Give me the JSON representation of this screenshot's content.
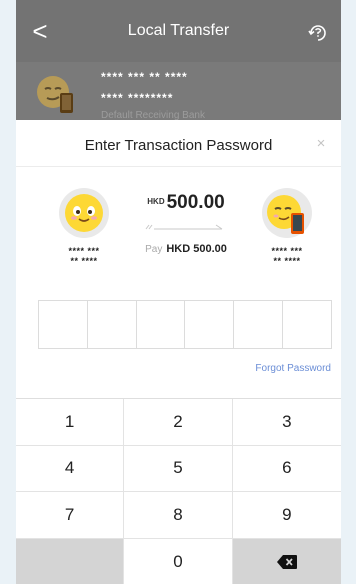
{
  "header": {
    "back_glyph": "<",
    "title": "Local Transfer",
    "help_icon": "help-icon"
  },
  "account": {
    "line1": "**** *** ** ****",
    "line2": "**** ********",
    "line3": "Default Receiving Bank"
  },
  "modal": {
    "title": "Enter Transaction Password",
    "close_glyph": "×",
    "sender": {
      "masked1": "**** ***",
      "masked2": "** ****"
    },
    "receiver": {
      "masked1": "**** ***",
      "masked2": "** ****"
    },
    "amount": {
      "currency": "HKD",
      "value": "500.00"
    },
    "pay": {
      "label": "Pay",
      "value": "HKD 500.00"
    },
    "pin_length": 6,
    "forgot_label": "Forgot Password"
  },
  "keypad": {
    "keys": [
      "1",
      "2",
      "3",
      "4",
      "5",
      "6",
      "7",
      "8",
      "9",
      "",
      "0",
      "backspace"
    ]
  },
  "colors": {
    "link": "#6b8ed6",
    "overlay": "#737373",
    "key_special": "#d4d4d4"
  }
}
